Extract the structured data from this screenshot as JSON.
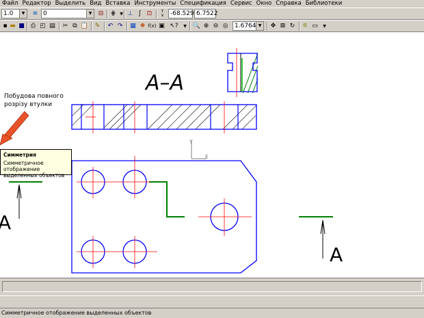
{
  "menu": [
    "Файл",
    "Редактор",
    "Выделить",
    "Вид",
    "Вставка",
    "Инструменты",
    "Спецификация",
    "Сервис",
    "Окно",
    "Справка",
    "Библиотеки"
  ],
  "toolbar1": {
    "line_scale": "1.0",
    "layer": "0",
    "coord_x": "-68.529",
    "coord_y": "6.7522",
    "coord_label": "Y\nx"
  },
  "toolbar2": {
    "zoom": "1.6764"
  },
  "drawing": {
    "section_title": "A–A",
    "note_line1": "Побудова повного",
    "note_line2": "розрізу втулки",
    "axis_y": "Y",
    "axis_x": "X",
    "letter_left": "A",
    "letter_right": "A",
    "colors": {
      "outline": "#0000ff",
      "axis": "#ff0000",
      "hatch": "#000000",
      "cut": "#008000",
      "arrow": "#e8542a"
    }
  },
  "tooltip": {
    "title": "Симметрия",
    "desc_line1": "Симметричное отображение",
    "desc_line2": "выделенных объектов"
  },
  "status_text": "Симметричное отображение выделенных объектов"
}
